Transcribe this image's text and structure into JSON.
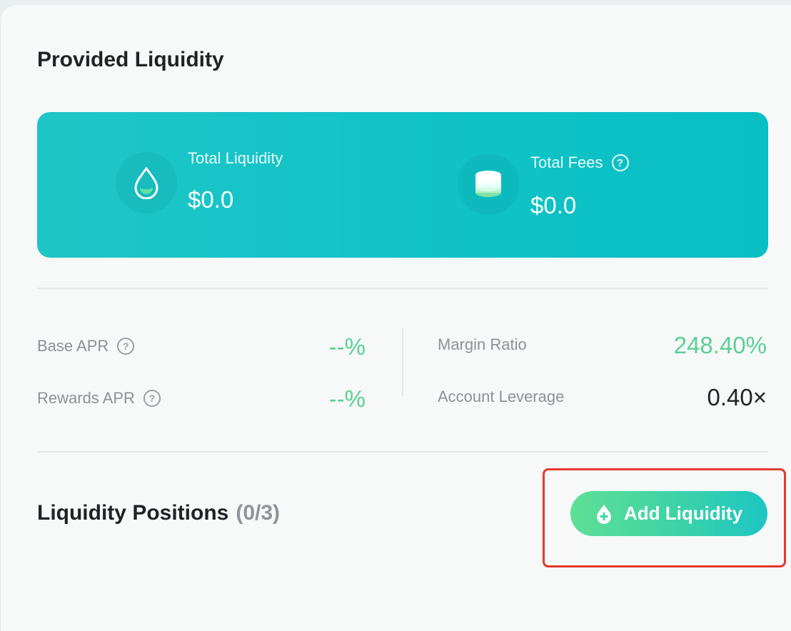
{
  "panel": {
    "title": "Provided Liquidity"
  },
  "stats": {
    "total_liquidity": {
      "label": "Total Liquidity",
      "value": "$0.0",
      "icon": "droplet-icon"
    },
    "total_fees": {
      "label": "Total Fees",
      "value": "$0.0",
      "icon": "coins-stack-icon",
      "help_icon": "question-circle-icon"
    }
  },
  "metrics": {
    "base_apr": {
      "label": "Base APR",
      "value": "--%"
    },
    "rewards_apr": {
      "label": "Rewards APR",
      "value": "--%"
    },
    "margin_ratio": {
      "label": "Margin Ratio",
      "value": "248.40%"
    },
    "account_leverage": {
      "label": "Account Leverage",
      "value": "0.40×"
    }
  },
  "positions": {
    "title": "Liquidity Positions",
    "count": "(0/3)",
    "add_button_label": "Add Liquidity",
    "add_button_icon": "droplet-plus-icon"
  },
  "colors": {
    "accent_teal": "#11c3c6",
    "positive_green": "#5bcf97",
    "highlight_red": "#e23b2e"
  }
}
